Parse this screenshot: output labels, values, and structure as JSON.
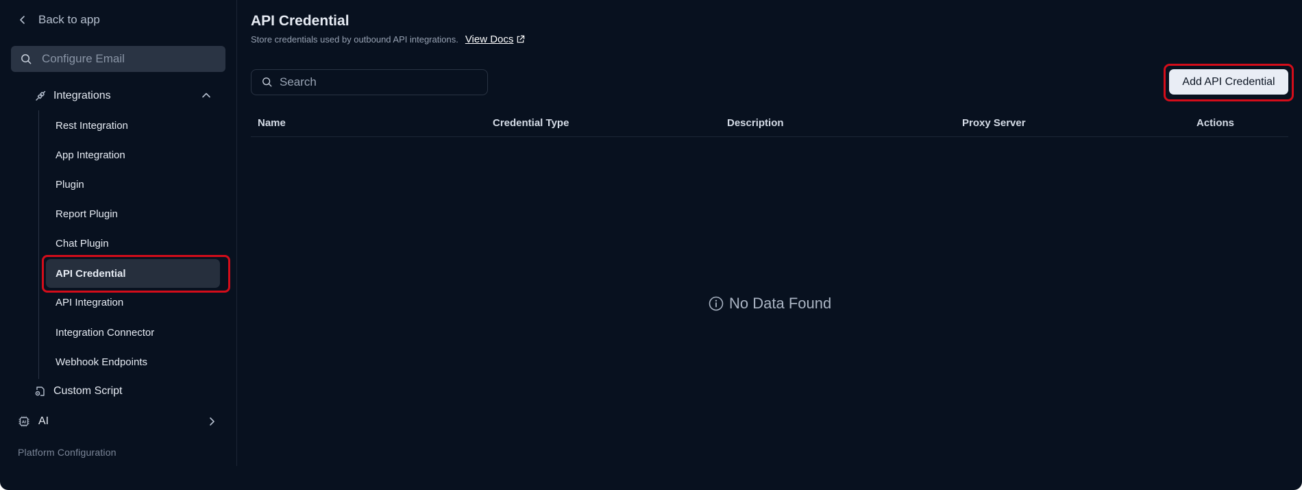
{
  "sidebar": {
    "back_label": "Back to app",
    "search_placeholder": "Configure Email",
    "group_label": "Integrations",
    "items": [
      {
        "label": "Rest Integration"
      },
      {
        "label": "App Integration"
      },
      {
        "label": "Plugin"
      },
      {
        "label": "Report Plugin"
      },
      {
        "label": "Chat Plugin"
      },
      {
        "label": "API Credential",
        "active": true
      },
      {
        "label": "API Integration"
      },
      {
        "label": "Integration Connector"
      },
      {
        "label": "Webhook Endpoints"
      }
    ],
    "custom_script_label": "Custom Script",
    "ai_label": "AI",
    "section_label": "Platform Configuration"
  },
  "main": {
    "title": "API Credential",
    "subtitle": "Store credentials used by outbound API integrations.",
    "docs_label": "View Docs",
    "search_placeholder": "Search",
    "add_button_label": "Add API Credential",
    "columns": [
      "Name",
      "Credential Type",
      "Description",
      "Proxy Server",
      "Actions"
    ],
    "empty_text": "No Data Found"
  },
  "colors": {
    "background": "#08111f",
    "highlight": "#d40d1a",
    "active_item": "#262f3d",
    "button": "#e9edf5"
  }
}
